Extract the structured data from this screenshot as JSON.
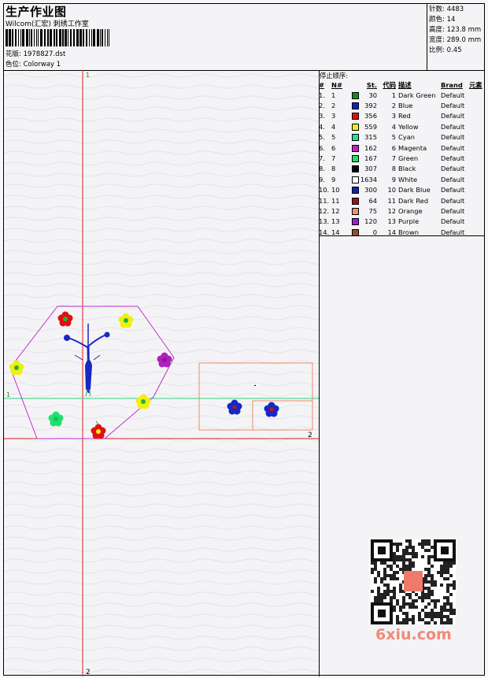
{
  "header": {
    "title": "生产作业图",
    "subtitle": "Wilcom(汇宏) 刺绣工作室",
    "design_label": "花版:",
    "design_value": "1978827.dst",
    "colorway_label": "色位:",
    "colorway_value": "Colorway 1"
  },
  "stats": {
    "stitches_label": "针数:",
    "stitches_value": "4483",
    "colors_label": "颜色:",
    "colors_value": "14",
    "height_label": "高度:",
    "height_value": "123.8 mm",
    "width_label": "宽度:",
    "width_value": "289.0 mm",
    "scale_label": "比例:",
    "scale_value": "0.45"
  },
  "canvas": {
    "axis_v1_label": "1",
    "axis_v1_bottom_label": "2",
    "axis_h1_label": "1",
    "axis_h1_right_label": "2"
  },
  "stop_sequence": {
    "title": "停止顺序:",
    "headers": {
      "hash": "#",
      "n": "N#",
      "st": "St.",
      "code": "代码",
      "desc": "描述",
      "brand": "Brand",
      "elem": "元素"
    },
    "rows": [
      {
        "idx": "1.",
        "n": "1",
        "st": "30",
        "code": "1",
        "desc": "Dark Green",
        "brand": "Default",
        "color": "#1a8a1a"
      },
      {
        "idx": "2.",
        "n": "2",
        "st": "392",
        "code": "2",
        "desc": "Blue",
        "brand": "Default",
        "color": "#1020c8"
      },
      {
        "idx": "3.",
        "n": "3",
        "st": "356",
        "code": "3",
        "desc": "Red",
        "brand": "Default",
        "color": "#e01010"
      },
      {
        "idx": "4.",
        "n": "4",
        "st": "559",
        "code": "4",
        "desc": "Yellow",
        "brand": "Default",
        "color": "#f0f010"
      },
      {
        "idx": "5.",
        "n": "5",
        "st": "315",
        "code": "5",
        "desc": "Cyan",
        "brand": "Default",
        "color": "#20e0a0"
      },
      {
        "idx": "6.",
        "n": "6",
        "st": "162",
        "code": "6",
        "desc": "Magenta",
        "brand": "Default",
        "color": "#c020c0"
      },
      {
        "idx": "7.",
        "n": "7",
        "st": "167",
        "code": "7",
        "desc": "Green",
        "brand": "Default",
        "color": "#20e060"
      },
      {
        "idx": "8.",
        "n": "8",
        "st": "307",
        "code": "8",
        "desc": "Black",
        "brand": "Default",
        "color": "#000000"
      },
      {
        "idx": "9.",
        "n": "9",
        "st": "1634",
        "code": "9",
        "desc": "White",
        "brand": "Default",
        "color": "#ffffff"
      },
      {
        "idx": "10.",
        "n": "10",
        "st": "300",
        "code": "10",
        "desc": "Dark Blue",
        "brand": "Default",
        "color": "#1020b0"
      },
      {
        "idx": "11.",
        "n": "11",
        "st": "64",
        "code": "11",
        "desc": "Dark Red",
        "brand": "Default",
        "color": "#901818"
      },
      {
        "idx": "12.",
        "n": "12",
        "st": "75",
        "code": "12",
        "desc": "Orange",
        "brand": "Default",
        "color": "#f09070"
      },
      {
        "idx": "13.",
        "n": "13",
        "st": "120",
        "code": "13",
        "desc": "Purple",
        "brand": "Default",
        "color": "#a020d0"
      },
      {
        "idx": "14.",
        "n": "14",
        "st": "0",
        "code": "14",
        "desc": "Brown",
        "brand": "Default",
        "color": "#905030"
      }
    ]
  },
  "watermark": {
    "text": "6xiu.com"
  }
}
